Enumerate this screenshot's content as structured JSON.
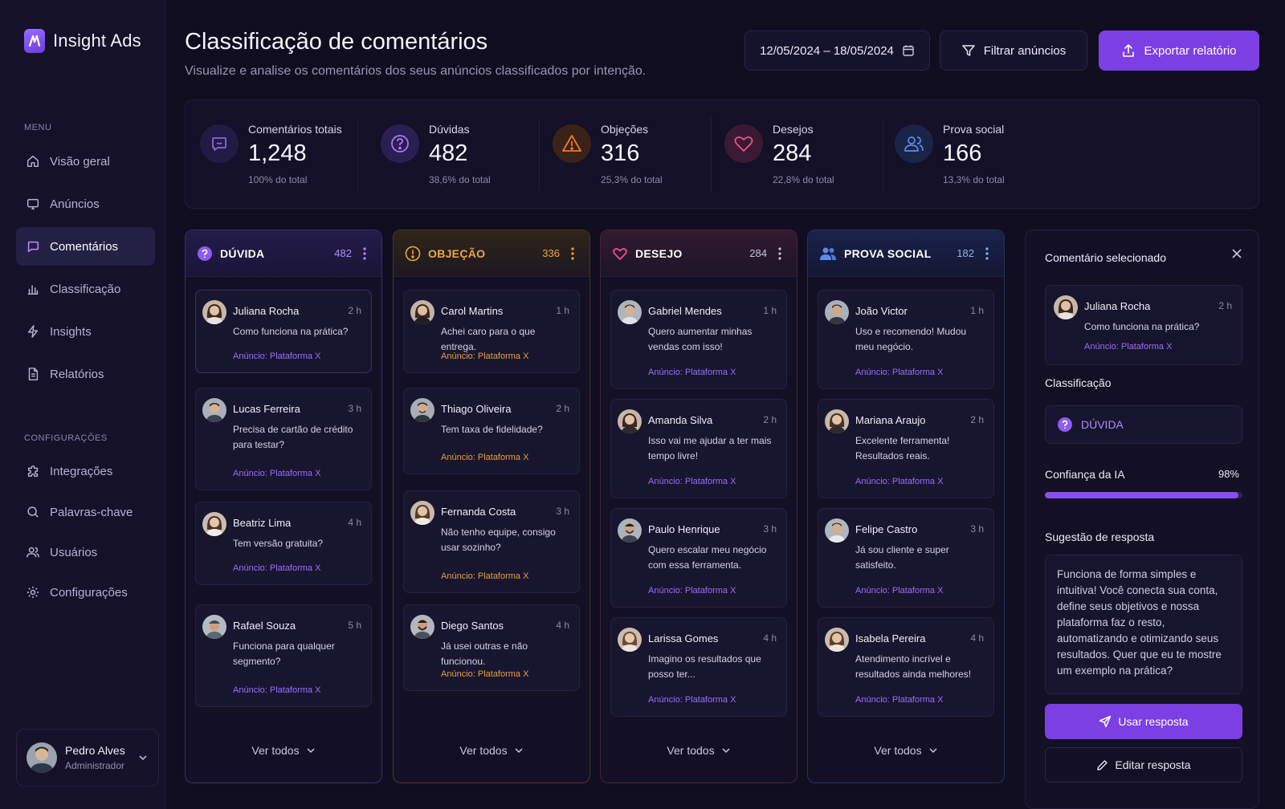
{
  "app": {
    "name": "Insight Ads"
  },
  "sidebar": {
    "menu_heading": "MENU",
    "menu": [
      {
        "label": "Visão geral",
        "icon": "home-icon"
      },
      {
        "label": "Anúncios",
        "icon": "monitor-icon"
      },
      {
        "label": "Comentários",
        "icon": "comment-icon",
        "active": true
      },
      {
        "label": "Classificação",
        "icon": "bar-chart-icon"
      },
      {
        "label": "Insights",
        "icon": "lightning-icon"
      },
      {
        "label": "Relatórios",
        "icon": "document-icon"
      }
    ],
    "config_heading": "CONFIGURAÇÕES",
    "config": [
      {
        "label": "Integrações",
        "icon": "puzzle-icon"
      },
      {
        "label": "Palavras-chave",
        "icon": "search-icon"
      },
      {
        "label": "Usuários",
        "icon": "users-icon"
      },
      {
        "label": "Configurações",
        "icon": "gear-icon"
      }
    ],
    "user": {
      "name": "Pedro Alves",
      "role": "Administrador"
    }
  },
  "header": {
    "title": "Classificação de comentários",
    "subtitle": "Visualize e analise os comentários dos seus anúncios classificados por intenção.",
    "date_range": "12/05/2024 – 18/05/2024",
    "filter_label": "Filtrar anúncios",
    "export_label": "Exportar relatório"
  },
  "stats": [
    {
      "label": "Comentários totais",
      "value": "1,248",
      "pct": "100% do total",
      "color": "#7b5ad6",
      "icon": "chat-icon"
    },
    {
      "label": "Dúvidas",
      "value": "482",
      "pct": "38,6% do total",
      "color": "#a77cff",
      "icon": "question-icon"
    },
    {
      "label": "Objeções",
      "value": "316",
      "pct": "25,3% do total",
      "color": "#f07a2c",
      "icon": "warning-icon"
    },
    {
      "label": "Desejos",
      "value": "284",
      "pct": "22,8% do total",
      "color": "#ef4f8f",
      "icon": "heart-icon"
    },
    {
      "label": "Prova social",
      "value": "166",
      "pct": "13,3% do total",
      "color": "#5b8cf0",
      "icon": "users-icon"
    }
  ],
  "columns": [
    {
      "title": "DÚVIDA",
      "count": "482",
      "color": "#a77cff",
      "icon": "question-icon",
      "cards": [
        {
          "name": "Juliana Rocha",
          "time": "2 h",
          "text": "Como funciona na prática?",
          "ad": "Anúncio: Plataforma X"
        },
        {
          "name": "Lucas Ferreira",
          "time": "3 h",
          "text": "Precisa de cartão de crédito para testar?",
          "ad": "Anúncio: Plataforma X"
        },
        {
          "name": "Beatriz Lima",
          "time": "4 h",
          "text": "Tem versão gratuita?",
          "ad": "Anúncio: Plataforma X"
        },
        {
          "name": "Rafael Souza",
          "time": "5 h",
          "text": "Funciona para qualquer segmento?",
          "ad": "Anúncio: Plataforma X"
        }
      ],
      "ver_todos": "Ver todos"
    },
    {
      "title": "OBJEÇÃO",
      "count": "336",
      "color": "#f0a63a",
      "icon": "warning-icon",
      "cards": [
        {
          "name": "Carol Martins",
          "time": "1 h",
          "text": "Achei caro para o que entrega.",
          "ad": "Anúncio: Plataforma X"
        },
        {
          "name": "Thiago Oliveira",
          "time": "2 h",
          "text": "Tem taxa de fidelidade?",
          "ad": "Anúncio: Plataforma X"
        },
        {
          "name": "Fernanda Costa",
          "time": "3 h",
          "text": "Não tenho equipe, consigo usar sozinho?",
          "ad": "Anúncio: Plataforma X"
        },
        {
          "name": "Diego Santos",
          "time": "4 h",
          "text": "Já usei outras e não funcionou.",
          "ad": "Anúncio: Plataforma X"
        }
      ],
      "ver_todos": "Ver todos"
    },
    {
      "title": "DESEJO",
      "count": "284",
      "color": "#ef4f8f",
      "icon": "heart-icon",
      "cards": [
        {
          "name": "Gabriel Mendes",
          "time": "1 h",
          "text": "Quero aumentar minhas vendas com isso!",
          "ad": "Anúncio: Plataforma X"
        },
        {
          "name": "Amanda Silva",
          "time": "2 h",
          "text": "Isso vai me ajudar a ter mais tempo livre!",
          "ad": "Anúncio: Plataforma X"
        },
        {
          "name": "Paulo Henrique",
          "time": "3 h",
          "text": "Quero escalar meu negócio com essa ferramenta.",
          "ad": "Anúncio: Plataforma X"
        },
        {
          "name": "Larissa Gomes",
          "time": "4 h",
          "text": "Imagino os resultados que posso ter...",
          "ad": "Anúncio: Plataforma X"
        }
      ],
      "ver_todos": "Ver todos"
    },
    {
      "title": "PROVA SOCIAL",
      "count": "182",
      "color": "#5b8cf0",
      "icon": "users-icon",
      "cards": [
        {
          "name": "João Victor",
          "time": "1 h",
          "text": "Uso e recomendo! Mudou meu negócio.",
          "ad": "Anúncio: Plataforma X"
        },
        {
          "name": "Mariana Araujo",
          "time": "2 h",
          "text": "Excelente ferramenta! Resultados reais.",
          "ad": "Anúncio: Plataforma X"
        },
        {
          "name": "Felipe Castro",
          "time": "3 h",
          "text": "Já sou cliente e super satisfeito.",
          "ad": "Anúncio: Plataforma X"
        },
        {
          "name": "Isabela Pereira",
          "time": "4 h",
          "text": "Atendimento incrível e resultados ainda melhores!",
          "ad": "Anúncio: Plataforma X"
        }
      ],
      "ver_todos": "Ver todos"
    }
  ],
  "panel": {
    "title": "Comentário selecionado",
    "selected": {
      "name": "Juliana Rocha",
      "time": "2 h",
      "text": "Como funciona na prática?",
      "ad": "Anúncio: Plataforma X"
    },
    "classification_label": "Classificação",
    "classification_value": "DÚVIDA",
    "confidence_label": "Confiança da IA",
    "confidence_value": "98%",
    "confidence_fraction": 0.98,
    "suggestion_label": "Sugestão de resposta",
    "suggestion_text": "Funciona de forma simples e intuitiva! Você conecta sua conta, define seus objetivos e nossa plataforma faz o resto, automatizando e otimizando seus resultados. Quer que eu te mostre um exemplo na prática?",
    "use_label": "Usar resposta",
    "edit_label": "Editar resposta"
  },
  "colors": {
    "accent": "#7b3fe4",
    "background": "#0f0d1f",
    "panel": "#131026"
  }
}
